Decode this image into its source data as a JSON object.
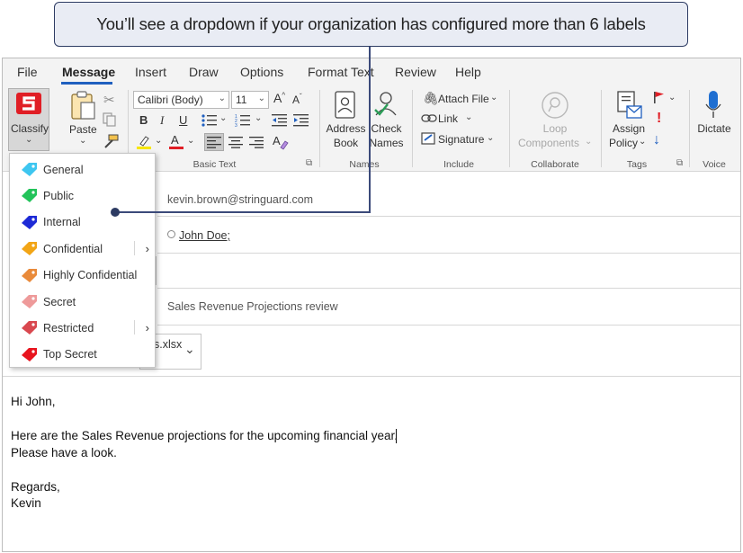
{
  "callout": {
    "text": "You’ll see a dropdown if your organization has configured more than 6 labels"
  },
  "menu": {
    "tabs": [
      "File",
      "Message",
      "Insert",
      "Draw",
      "Options",
      "Format Text",
      "Review",
      "Help"
    ],
    "active": "Message"
  },
  "ribbon": {
    "classify": {
      "label": "Classify",
      "brand_color": "#e01e25"
    },
    "clipboard": {
      "paste_label": "Paste"
    },
    "basic_text": {
      "font_value": "Calibri (Body)",
      "size_value": "11",
      "group_label": "Basic Text"
    },
    "names": {
      "address_book_line1": "Address",
      "address_book_line2": "Book",
      "check_names_line1": "Check",
      "check_names_line2": "Names",
      "group_label": "Names"
    },
    "include": {
      "attach_file": "Attach File",
      "link": "Link",
      "signature": "Signature",
      "group_label": "Include"
    },
    "collaborate": {
      "loop_line1": "Loop",
      "loop_line2": "Components",
      "group_label": "Collaborate"
    },
    "tags": {
      "assign_line1": "Assign",
      "assign_line2": "Policy",
      "group_label": "Tags"
    },
    "voice": {
      "dictate": "Dictate",
      "group_label": "Voice"
    }
  },
  "classify_dropdown": {
    "items": [
      {
        "label": "General",
        "color": "#3ec6f0",
        "submenu": false
      },
      {
        "label": "Public",
        "color": "#22c35a",
        "submenu": false
      },
      {
        "label": "Internal",
        "color": "#1d2ad6",
        "submenu": false
      },
      {
        "label": "Confidential",
        "color": "#f2a516",
        "submenu": true
      },
      {
        "label": "Highly Confidential",
        "color": "#e98a3a",
        "submenu": false
      },
      {
        "label": "Secret",
        "color": "#ee9a9a",
        "submenu": false
      },
      {
        "label": "Restricted",
        "color": "#d9484f",
        "submenu": true
      },
      {
        "label": "Top Secret",
        "color": "#e8141e",
        "submenu": false
      }
    ]
  },
  "message": {
    "from": "kevin.brown@stringuard.com",
    "to": "John Doe;",
    "subject": "Sales Revenue Projections review",
    "attachment_name": "s.xlsx",
    "body": {
      "greeting": "Hi John,",
      "line1": "Here are the Sales Revenue projections for the upcoming financial year.",
      "line2": "Please have a look.",
      "closing": "Regards,",
      "signature": "Kevin"
    }
  }
}
